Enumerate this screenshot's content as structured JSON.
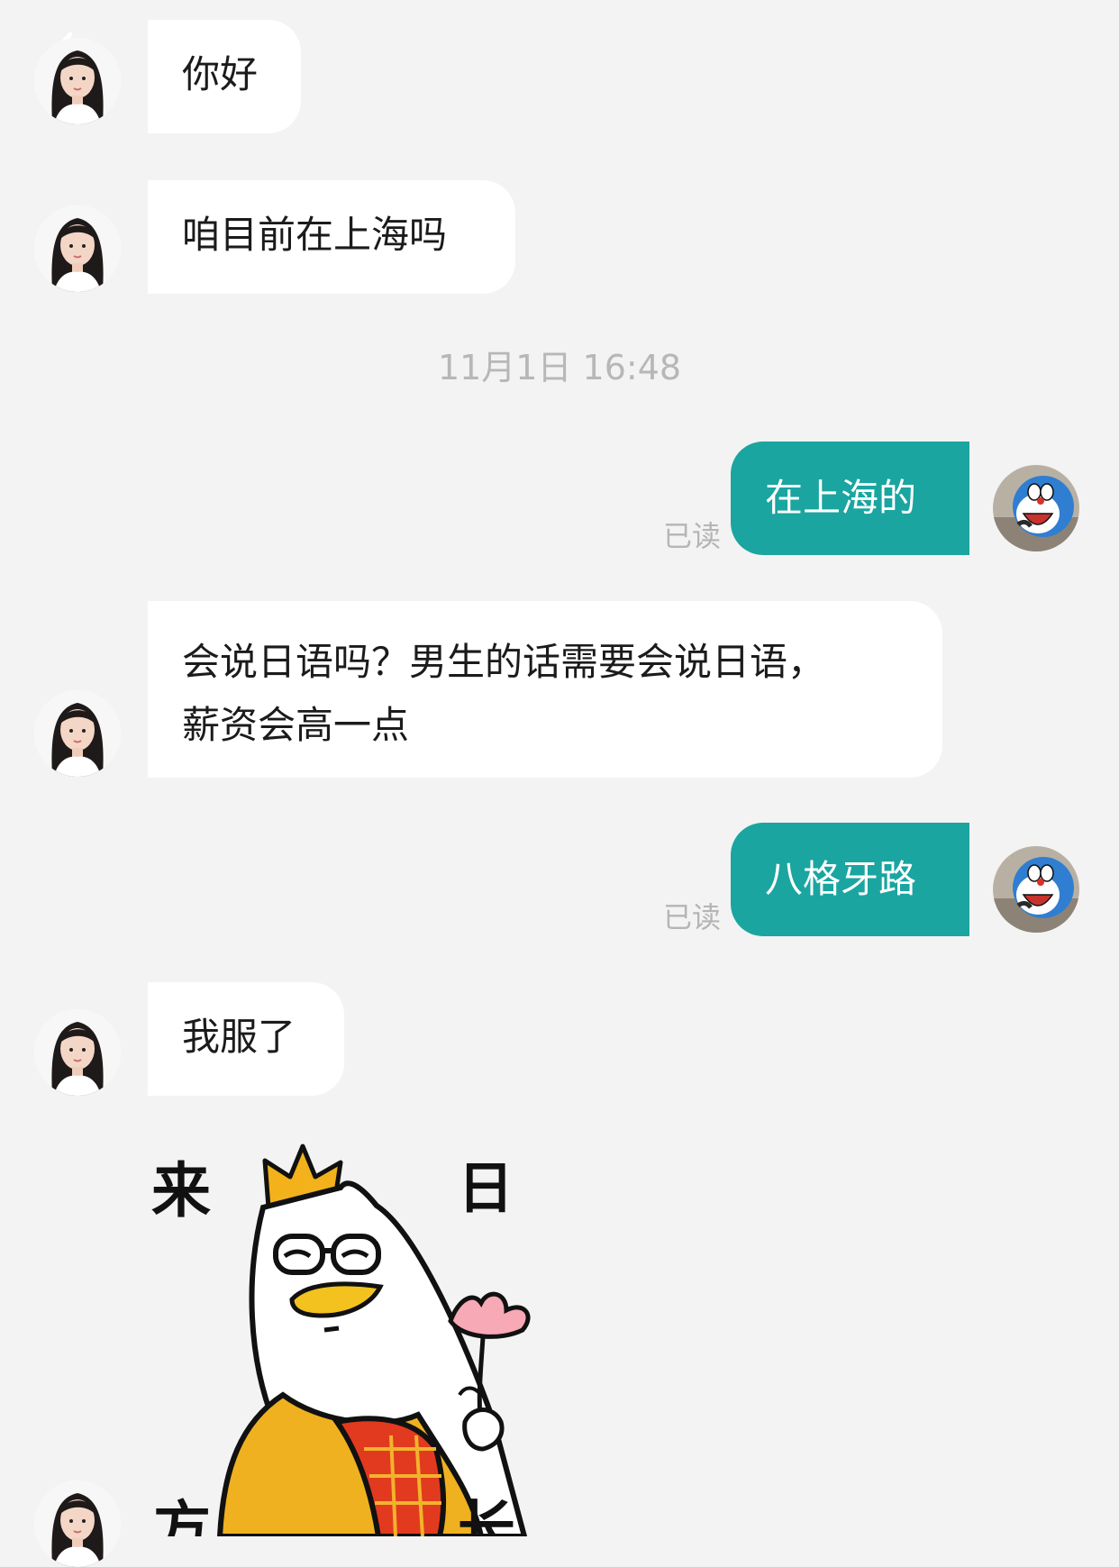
{
  "timestamp": "11月1日 16:48",
  "messages": [
    {
      "from": "contact",
      "text": "你好"
    },
    {
      "from": "contact",
      "text": "咱目前在上海吗"
    },
    {
      "from": "self",
      "text": "在上海的",
      "status": "已读"
    },
    {
      "from": "contact",
      "text": "会说日语吗？男生的话需要会说日语，\n薪资会高一点"
    },
    {
      "from": "self",
      "text": "八格牙路",
      "status": "已读"
    },
    {
      "from": "contact",
      "text": "我服了"
    },
    {
      "from": "contact",
      "type": "sticker",
      "sticker_text": [
        "来",
        "日",
        "方",
        "长"
      ]
    }
  ],
  "icons": {
    "back": "chevron-left-icon",
    "contact_avatar": "woman-portrait-avatar",
    "self_avatar": "doraemon-avatar"
  },
  "colors": {
    "background": "#f3f3f3",
    "incoming_bubble": "#ffffff",
    "outgoing_bubble": "#1aa5a0",
    "outgoing_text": "#ffffff",
    "meta_text": "#b5b5b5"
  }
}
